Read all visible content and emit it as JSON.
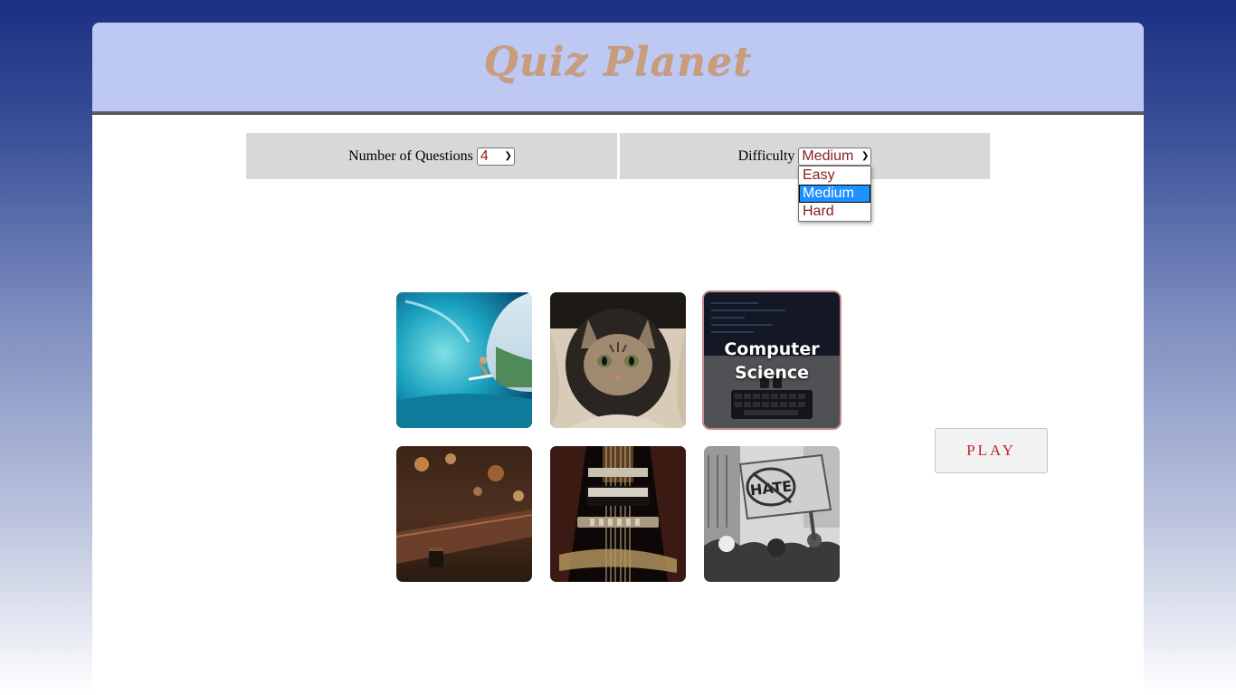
{
  "app": {
    "title": "Quiz Planet"
  },
  "options": {
    "questions_label": "Number of Questions",
    "questions_value": "4",
    "difficulty_label": "Difficulty",
    "difficulty_value": "Medium",
    "difficulty_options": [
      "Easy",
      "Medium",
      "Hard"
    ]
  },
  "categories": [
    {
      "image": "surfing-wave-photo",
      "label": ""
    },
    {
      "image": "kitten-photo",
      "label": ""
    },
    {
      "image": "laptop-keyboard-photo",
      "label": "Computer Science",
      "label_line1": "Computer",
      "label_line2": "Science",
      "selected": true
    },
    {
      "image": "bar-counter-photo",
      "label": ""
    },
    {
      "image": "guitar-strings-photo",
      "label": ""
    },
    {
      "image": "protest-hate-sign-photo",
      "label": "",
      "sign_text": "HATE"
    }
  ],
  "play": {
    "label": "PLAY"
  },
  "colors": {
    "header_bg": "#bec9f3",
    "title_color": "#c99c7c",
    "select_text": "#8a1c1c",
    "play_text": "#c0262d",
    "option_bg": "#d8d8d8"
  }
}
